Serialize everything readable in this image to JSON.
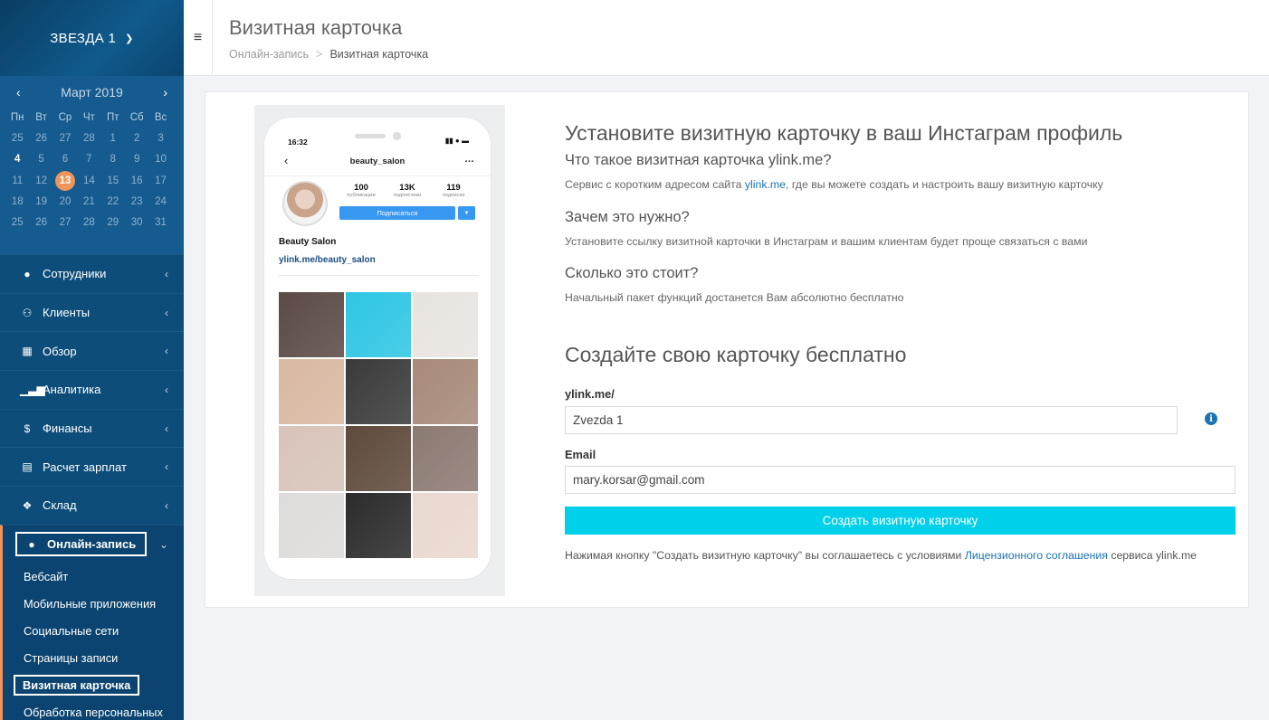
{
  "sidebar": {
    "org_name": "ЗВЕЗДА 1",
    "calendar": {
      "month": "Март 2019",
      "weekdays": [
        "Пн",
        "Вт",
        "Ср",
        "Чт",
        "Пт",
        "Сб",
        "Вс"
      ],
      "rows": [
        [
          "25",
          "26",
          "27",
          "28",
          "1",
          "2",
          "3"
        ],
        [
          "4",
          "5",
          "6",
          "7",
          "8",
          "9",
          "10"
        ],
        [
          "11",
          "12",
          "13",
          "14",
          "15",
          "16",
          "17"
        ],
        [
          "18",
          "19",
          "20",
          "21",
          "22",
          "23",
          "24"
        ],
        [
          "25",
          "26",
          "27",
          "28",
          "29",
          "30",
          "31"
        ]
      ],
      "today": "13"
    },
    "menu": [
      {
        "label": "Сотрудники",
        "icon": "user-icon"
      },
      {
        "label": "Клиенты",
        "icon": "users-icon"
      },
      {
        "label": "Обзор",
        "icon": "grid-icon"
      },
      {
        "label": "Аналитика",
        "icon": "bar-chart-icon"
      },
      {
        "label": "Финансы",
        "icon": "dollar-icon"
      },
      {
        "label": "Расчет зарплат",
        "icon": "id-card-icon"
      },
      {
        "label": "Склад",
        "icon": "boxes-icon"
      }
    ],
    "active_menu": {
      "label": "Онлайн-запись",
      "icon": "globe-icon"
    },
    "submenu": [
      "Вебсайт",
      "Мобильные приложения",
      "Социальные сети",
      "Страницы записи",
      "Визитная карточка",
      "Обработка персональных"
    ]
  },
  "header": {
    "title": "Визитная карточка",
    "breadcrumb": [
      "Онлайн-запись",
      "Визитная карточка"
    ]
  },
  "phone": {
    "time": "16:32",
    "username": "beauty_salon",
    "stats": [
      {
        "value": "100",
        "label": "публикации"
      },
      {
        "value": "13K",
        "label": "подписчики"
      },
      {
        "value": "119",
        "label": "подписки"
      }
    ],
    "subscribe_label": "Подписаться",
    "bio_name": "Beauty Salon",
    "bio_link": "ylink.me/beauty_salon",
    "tile_colors": [
      "#5b4a45",
      "#2ec6e4",
      "#e8e4df",
      "#d9b8a2",
      "#3a3a3a",
      "#a78a78",
      "#d8c3b9",
      "#5e4a3c",
      "#8c7a72",
      "#dedcda",
      "#2c2b2b",
      "#e9d8cf"
    ]
  },
  "main": {
    "heading": "Установите визитную карточку в ваш Инстаграм профиль",
    "faq": [
      {
        "q": "Что такое визитная карточка ylink.me?",
        "a_before": "Сервис с коротким адресом сайта ",
        "a_link": "ylink.me",
        "a_after": ", где вы можете создать и настроить вашу визитную карточку"
      },
      {
        "q": "Зачем это нужно?",
        "a": "Установите ссылку визитной карточки в Инстаграм и вашим клиентам будет проще связаться с вами"
      },
      {
        "q": "Сколько это стоит?",
        "a": "Начальный пакет функций достанется Вам абсолютно бесплатно"
      }
    ],
    "form_heading": "Создайте свою карточку бесплатно",
    "ylink_label": "ylink.me/",
    "ylink_value": "Zvezda 1",
    "email_label": "Email",
    "email_value": "mary.korsar@gmail.com",
    "button_label": "Создать визитную карточку",
    "agree_before": "Нажимая кнопку \"Создать визитную карточку\" вы соглашаетесь с условиями ",
    "agree_link": "Лицензионного соглашения",
    "agree_after": " сервиса ylink.me"
  },
  "colors": {
    "accent": "#00d0ea",
    "sidebar": "#0d4d7a",
    "highlight": "#f0945a",
    "link": "#1a73b5"
  }
}
